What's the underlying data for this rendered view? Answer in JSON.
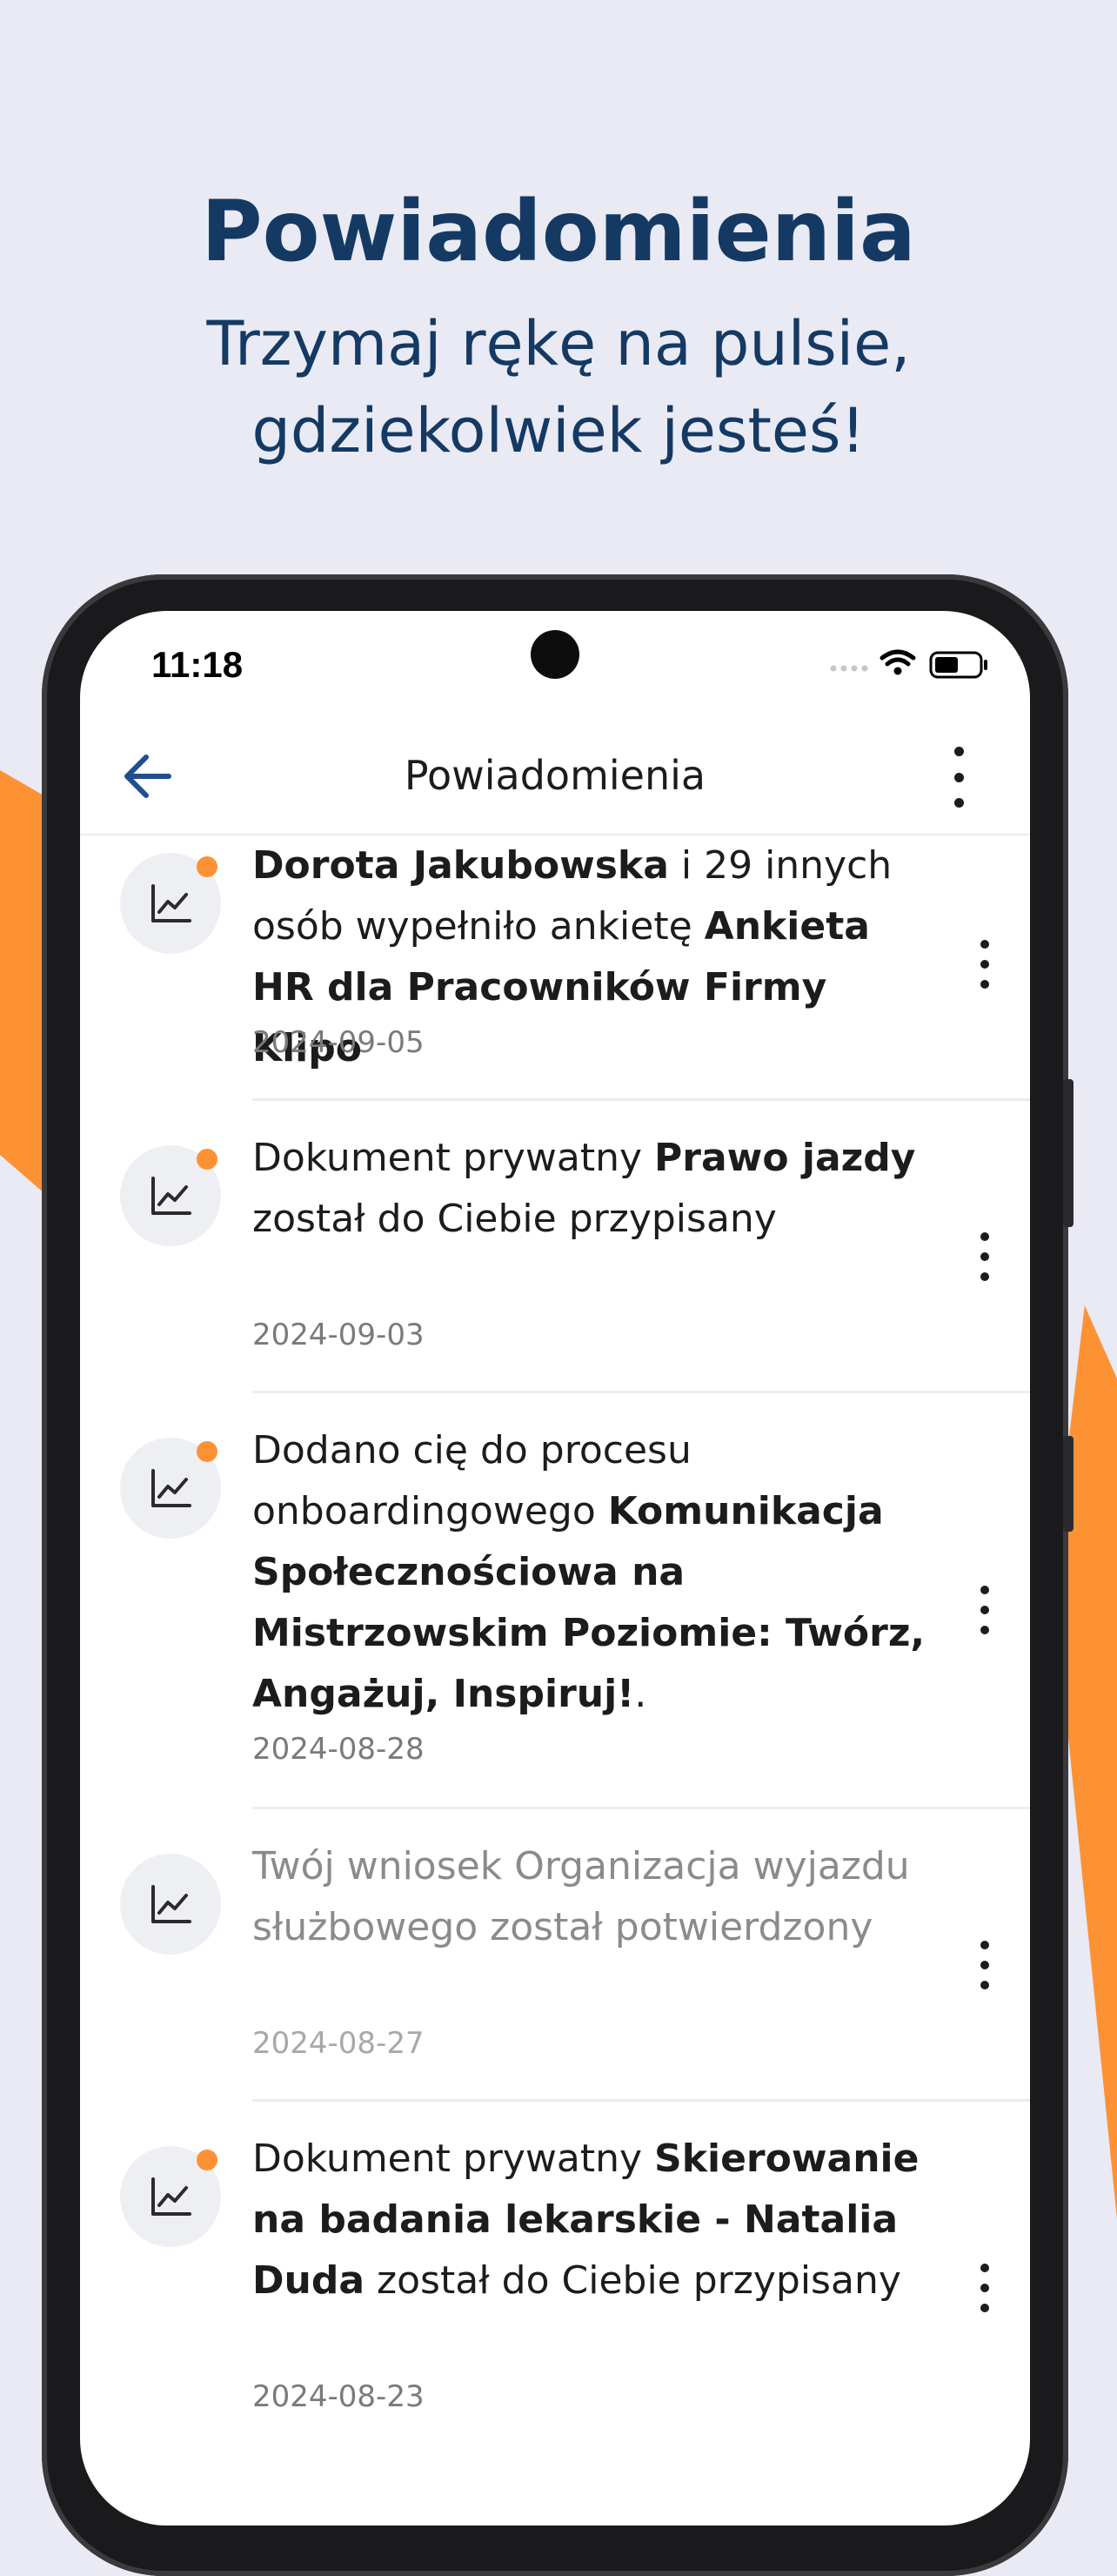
{
  "hero": {
    "title": "Powiadomienia",
    "subtitle_line1": "Trzymaj rękę na pulsie,",
    "subtitle_line2": "gdziekolwiek jesteś!"
  },
  "status_bar": {
    "time": "11:18"
  },
  "app_bar": {
    "title": "Powiadomienia",
    "back_icon": "arrow-left-icon",
    "menu_icon": "more-vertical-icon"
  },
  "colors": {
    "accent_orange": "#fd9235",
    "title_navy": "#143a64",
    "background": "#e9eaf4",
    "back_arrow": "#1f4f91"
  },
  "notifications": [
    {
      "icon": "chart-line-icon",
      "unread": true,
      "segments": [
        {
          "text": "Dorota Jakubowska",
          "bold": true
        },
        {
          "text": " i 29 innych osób wypełniło ankietę ",
          "bold": false
        },
        {
          "text": "Ankieta HR dla Pracowników Firmy Klipo",
          "bold": true
        }
      ],
      "date": "2024-09-05"
    },
    {
      "icon": "chart-line-icon",
      "unread": true,
      "segments": [
        {
          "text": "Dokument prywatny ",
          "bold": false
        },
        {
          "text": "Prawo jazdy",
          "bold": true
        },
        {
          "text": " został do Ciebie przypisany",
          "bold": false
        }
      ],
      "date": "2024-09-03"
    },
    {
      "icon": "chart-line-icon",
      "unread": true,
      "segments": [
        {
          "text": "Dodano cię do procesu onboardingowego ",
          "bold": false
        },
        {
          "text": "Komunikacja Społecznościowa na Mistrzowskim Poziomie: Twórz, Angażuj, Inspiruj!",
          "bold": true
        },
        {
          "text": ".",
          "bold": false
        }
      ],
      "date": "2024-08-28"
    },
    {
      "icon": "chart-line-icon",
      "unread": false,
      "segments": [
        {
          "text": "Twój wniosek Organizacja wyjazdu służbowego został potwierdzony",
          "bold": false
        }
      ],
      "date": "2024-08-27"
    },
    {
      "icon": "chart-line-icon",
      "unread": true,
      "segments": [
        {
          "text": "Dokument prywatny ",
          "bold": false
        },
        {
          "text": "Skierowanie na badania lekarskie - Natalia Duda",
          "bold": true
        },
        {
          "text": " został do Ciebie przypisany",
          "bold": false
        }
      ],
      "date": "2024-08-23"
    }
  ]
}
